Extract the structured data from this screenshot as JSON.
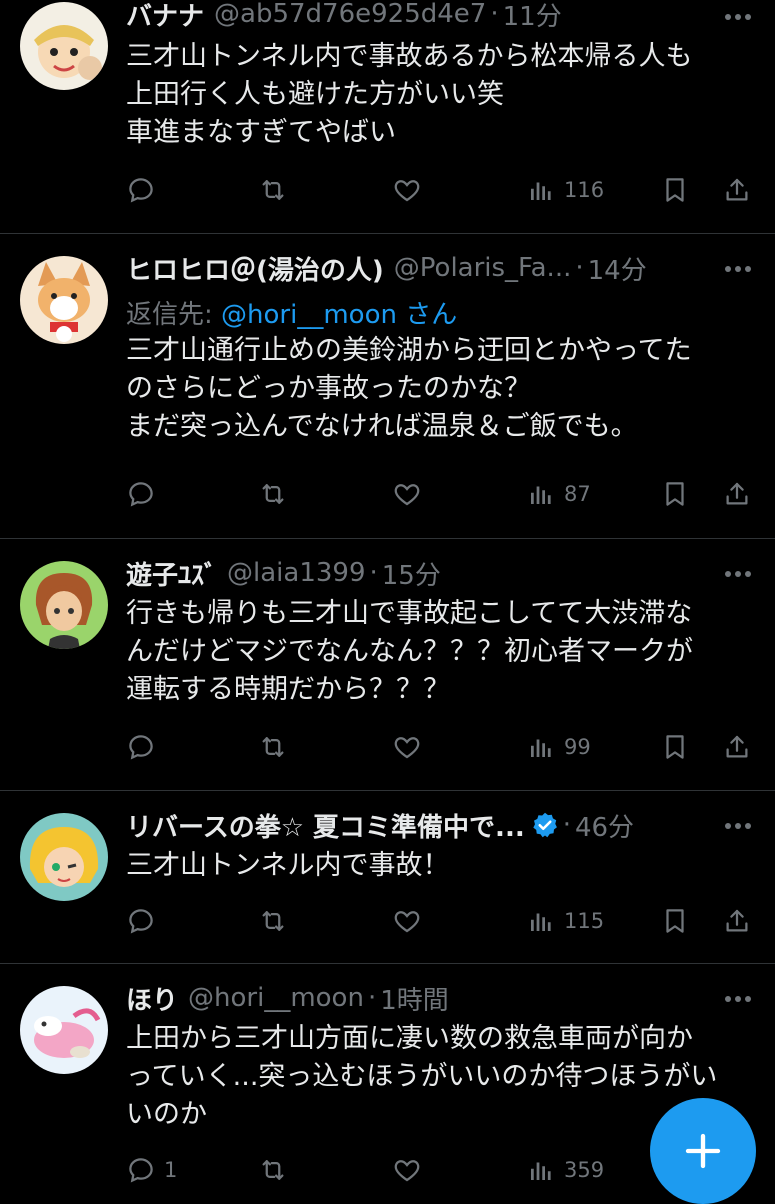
{
  "colors": {
    "background": "#000000",
    "text": "#e7e9ea",
    "muted": "#71767b",
    "accent": "#1d9bf0",
    "divider": "#2f3336"
  },
  "tweets": [
    {
      "name": "バナナ",
      "handle": "@ab57d76e925d4e7",
      "separator": "·",
      "time": "11分",
      "text": "三才山トンネル内で事故あるから松本帰る人も\n上田行く人も避けた方がいい笑\n車進まなすぎてやばい",
      "views": "116",
      "avatar_icon": "anime-character-avatar"
    },
    {
      "name": "ヒロヒロ＠(湯治の人)",
      "handle": "@Polaris_Fa...",
      "separator": "·",
      "time": "14分",
      "reply_prefix": "返信先:",
      "reply_mention": "@hori__moon",
      "reply_suffix": "さん",
      "text": "三才山通行止めの美鈴湖から迂回とかやってた\nのさらにどっか事故ったのかな？\nまだ突っ込んでなければ温泉＆ご飯でも。",
      "views": "87",
      "avatar_icon": "corgi-avatar"
    },
    {
      "name": "遊子ﾕｽﾞ",
      "handle": "@laia1399",
      "separator": "·",
      "time": "15分",
      "text": "行きも帰りも三才山で事故起こしてて大渋滞な\nんだけどマジでなんなん？？？初心者マークが\n運転する時期だから？？？",
      "views": "99",
      "avatar_icon": "anime-boy-avatar"
    },
    {
      "name": "リバースの拳☆ 夏コミ準備中で...",
      "handle": "",
      "separator": "·",
      "time": "46分",
      "verified": true,
      "text": "三才山トンネル内で事故！",
      "views": "115",
      "avatar_icon": "anime-girl-avatar"
    },
    {
      "name": "ほり",
      "handle": "@hori__moon",
      "separator": "·",
      "time": "1時間",
      "text": "上田から三才山方面に凄い数の救急車両が向か\nっていく...突っ込むほうがいいのか待つほうがい\nいのか",
      "replies": "1",
      "views": "359",
      "avatar_icon": "pink-creature-avatar"
    }
  ],
  "compose_button": {
    "icon": "plus-icon"
  }
}
